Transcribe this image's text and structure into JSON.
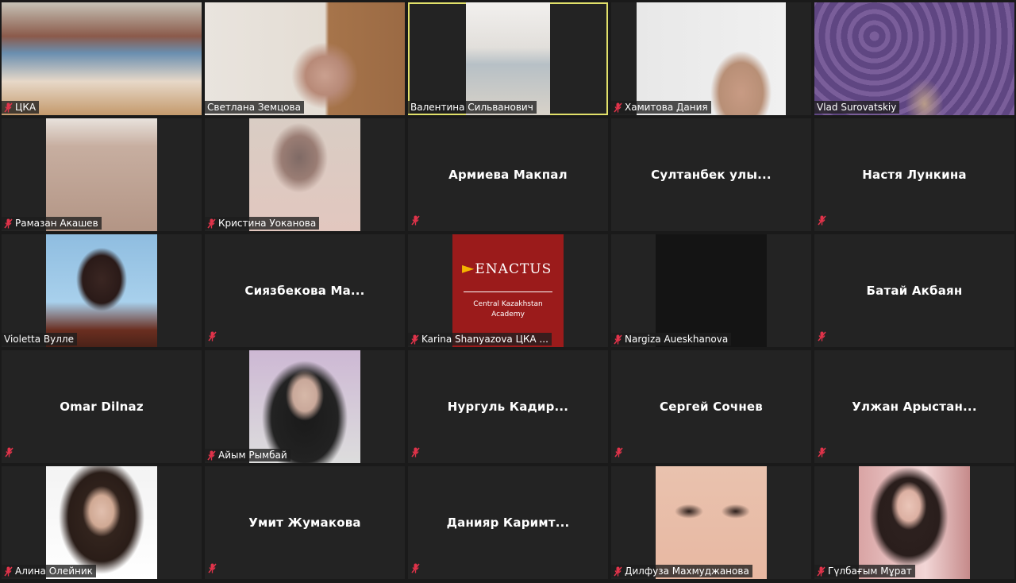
{
  "tiles": [
    {
      "name": "ЦКА",
      "video": "library",
      "muted": true,
      "active": false
    },
    {
      "name": "Светлана Земцова",
      "video": "woman-glasses",
      "muted": false,
      "active": false
    },
    {
      "name": "Валентина Сильванович",
      "video": "office-room",
      "muted": false,
      "active": true
    },
    {
      "name": "Хамитова Дания",
      "video": "woman-headphones",
      "muted": true,
      "active": false
    },
    {
      "name": "Vlad Surovatskiy",
      "video": "purple-wall",
      "muted": false,
      "active": false
    },
    {
      "name": "Рамазан Акашев",
      "video": "beige-wall",
      "muted": true,
      "active": false
    },
    {
      "name": "Кристина Уоканова",
      "video": "girl-pink",
      "muted": true,
      "active": false
    },
    {
      "name": "Армиева Макпал",
      "video": "",
      "muted": true,
      "active": false
    },
    {
      "name": "Султанбек улы...",
      "video": "",
      "muted": false,
      "active": false
    },
    {
      "name": "Настя Лункина",
      "video": "",
      "muted": true,
      "active": false
    },
    {
      "name": "Violetta Вулле",
      "video": "anime-avatar",
      "muted": false,
      "active": false
    },
    {
      "name": "Сиязбекова Ма...",
      "video": "",
      "muted": true,
      "active": false
    },
    {
      "name": "Karina Shanyazova ЦКА ...",
      "video": "enactus",
      "muted": true,
      "active": false
    },
    {
      "name": "Nargiza Aueskhanova",
      "video": "black",
      "muted": true,
      "active": false
    },
    {
      "name": "Батай Акбаян",
      "video": "",
      "muted": true,
      "active": false
    },
    {
      "name": "Omar Dilnaz",
      "video": "",
      "muted": true,
      "active": false
    },
    {
      "name": "Айым Рымбай",
      "video": "girl-hood",
      "muted": true,
      "active": false
    },
    {
      "name": "Нургуль Кадир...",
      "video": "",
      "muted": true,
      "active": false
    },
    {
      "name": "Сергей Сочнев",
      "video": "",
      "muted": true,
      "active": false
    },
    {
      "name": "Улжан Арыстан...",
      "video": "",
      "muted": true,
      "active": false
    },
    {
      "name": "Алина Олейник",
      "video": "girl-photo",
      "muted": true,
      "active": false
    },
    {
      "name": "Умит Жумакова",
      "video": "",
      "muted": true,
      "active": false
    },
    {
      "name": "Данияр Каримт...",
      "video": "",
      "muted": true,
      "active": false
    },
    {
      "name": "Дилфуза Махмуджанова",
      "video": "face-closeup",
      "muted": true,
      "active": false
    },
    {
      "name": "Гүлбағым Мұрат",
      "video": "girl-selfie",
      "muted": true,
      "active": false
    }
  ],
  "enactus": {
    "logo": "ENACTUS",
    "line1": "Central Kazakhstan",
    "line2": "Academy"
  },
  "colors": {
    "tile_bg": "#232323",
    "active_border": "#e1e06a",
    "muted_icon": "#e0334a"
  }
}
